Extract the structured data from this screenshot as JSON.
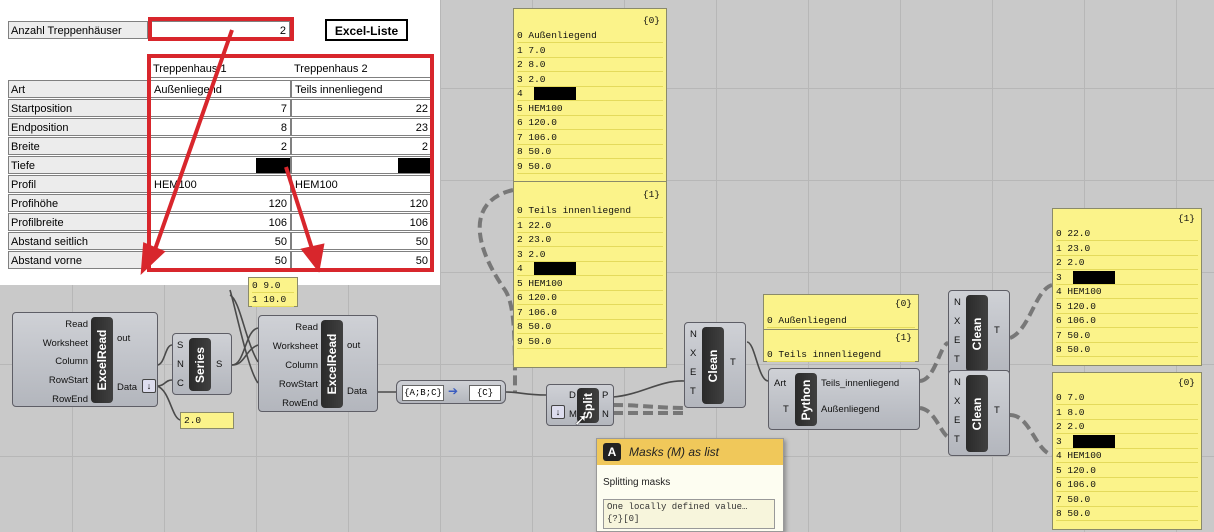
{
  "sheet": {
    "count_label": "Anzahl Treppenhäuser",
    "count_value": "2",
    "excel_button": "Excel-Liste",
    "col1": "Treppenhaus 1",
    "col2": "Treppenhaus 2",
    "rows": [
      {
        "label": "Art",
        "v1": "Außenliegend",
        "v2": "Teils innenliegend"
      },
      {
        "label": "Startposition",
        "v1": "7",
        "v2": "22"
      },
      {
        "label": "Endposition",
        "v1": "8",
        "v2": "23"
      },
      {
        "label": "Breite",
        "v1": "2",
        "v2": "2"
      },
      {
        "label": "Tiefe",
        "v1": "",
        "v2": ""
      },
      {
        "label": "Profil",
        "v1": "HEM100",
        "v2": "HEM100"
      },
      {
        "label": "Profihöhe",
        "v1": "120",
        "v2": "120"
      },
      {
        "label": "Profilbreite",
        "v1": "106",
        "v2": "106"
      },
      {
        "label": "Abstand seitlich",
        "v1": "50",
        "v2": "50"
      },
      {
        "label": "Abstand vorne",
        "v1": "50",
        "v2": "50"
      }
    ]
  },
  "components": {
    "excelread1": {
      "name": "ExcelRead",
      "in": [
        "Read",
        "Worksheet",
        "Column",
        "RowStart",
        "RowEnd"
      ],
      "out": [
        "out",
        "Data"
      ]
    },
    "series": {
      "name": "Series",
      "in": [
        "S",
        "N",
        "C"
      ],
      "out": [
        "S"
      ]
    },
    "excelread2": {
      "name": "ExcelRead",
      "in": [
        "Read",
        "Worksheet",
        "Column",
        "RowStart",
        "RowEnd"
      ],
      "out": [
        "out",
        "Data"
      ]
    },
    "path": {
      "from": "{A;B;C}",
      "to": "{C}"
    },
    "split": {
      "name": "Split",
      "in": [
        "D",
        "M"
      ],
      "out": [
        "P",
        "N"
      ]
    },
    "clean1": {
      "name": "Clean",
      "in": [
        "N",
        "X",
        "E",
        "T"
      ],
      "out": [
        "T"
      ]
    },
    "python": {
      "name": "Python",
      "in": [
        "Art",
        "T"
      ],
      "out": [
        "Teils_innenliegend",
        "Außenliegend"
      ]
    },
    "clean2": {
      "name": "Clean",
      "in": [
        "N",
        "X",
        "E",
        "T"
      ],
      "out": [
        "T"
      ]
    },
    "clean3": {
      "name": "Clean",
      "in": [
        "N",
        "X",
        "E",
        "T"
      ],
      "out": [
        "T"
      ]
    }
  },
  "panels": {
    "series_vals": [
      "0 9.0",
      "1 10.0"
    ],
    "step": "2.0",
    "main_branch0": {
      "title": "{0}",
      "items": [
        "0 Außenliegend",
        "1 7.0",
        "2 8.0",
        "3 2.0",
        "4",
        "5 HEM100",
        "6 120.0",
        "7 106.0",
        "8 50.0",
        "9 50.0"
      ]
    },
    "main_branch1": {
      "title": "{1}",
      "items": [
        "0 Teils innenliegend",
        "1 22.0",
        "2 23.0",
        "3 2.0",
        "4",
        "5 HEM100",
        "6 120.0",
        "7 106.0",
        "8 50.0",
        "9 50.0"
      ]
    },
    "mid_branch0": {
      "title": "{0}",
      "items": [
        "0 Außenliegend"
      ]
    },
    "mid_branch1": {
      "title": "{1}",
      "items": [
        "0 Teils innenliegend"
      ]
    },
    "right_top": {
      "title": "{1}",
      "items": [
        "0 22.0",
        "1 23.0",
        "2 2.0",
        "3",
        "4 HEM100",
        "5 120.0",
        "6 106.0",
        "7 50.0",
        "8 50.0"
      ]
    },
    "right_bottom": {
      "title": "{0}",
      "items": [
        "0 7.0",
        "1 8.0",
        "2 2.0",
        "3",
        "4 HEM100",
        "5 120.0",
        "6 106.0",
        "7 50.0",
        "8 50.0"
      ]
    }
  },
  "tooltip": {
    "icon": "A",
    "title": "Masks (M) as list",
    "subtitle": "Splitting masks",
    "body": "One locally defined value…",
    "path": "{?}[0]"
  }
}
